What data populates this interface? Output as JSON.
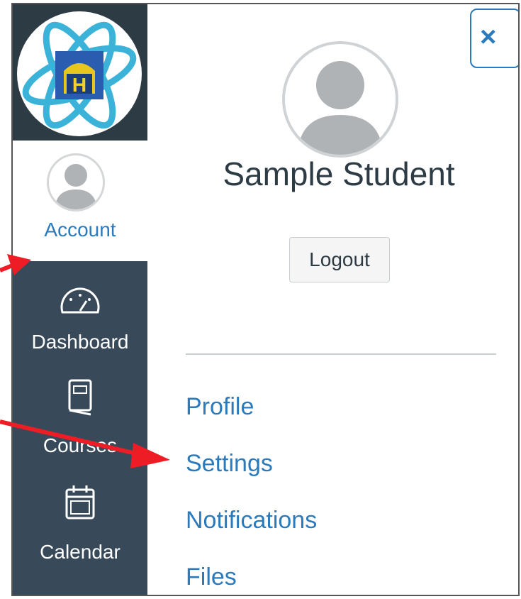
{
  "account": {
    "label": "Account",
    "user_name": "Sample Student",
    "logout_label": "Logout"
  },
  "nav": [
    {
      "label": "Dashboard",
      "icon": "dashboard-icon"
    },
    {
      "label": "Courses",
      "icon": "courses-icon"
    },
    {
      "label": "Calendar",
      "icon": "calendar-icon"
    }
  ],
  "menu": [
    {
      "label": "Profile"
    },
    {
      "label": "Settings"
    },
    {
      "label": "Notifications"
    },
    {
      "label": "Files"
    }
  ],
  "close_label": "×",
  "colors": {
    "rail": "#384a5a",
    "link": "#2b7abc",
    "annotation_arrow": "#ee1c25"
  }
}
